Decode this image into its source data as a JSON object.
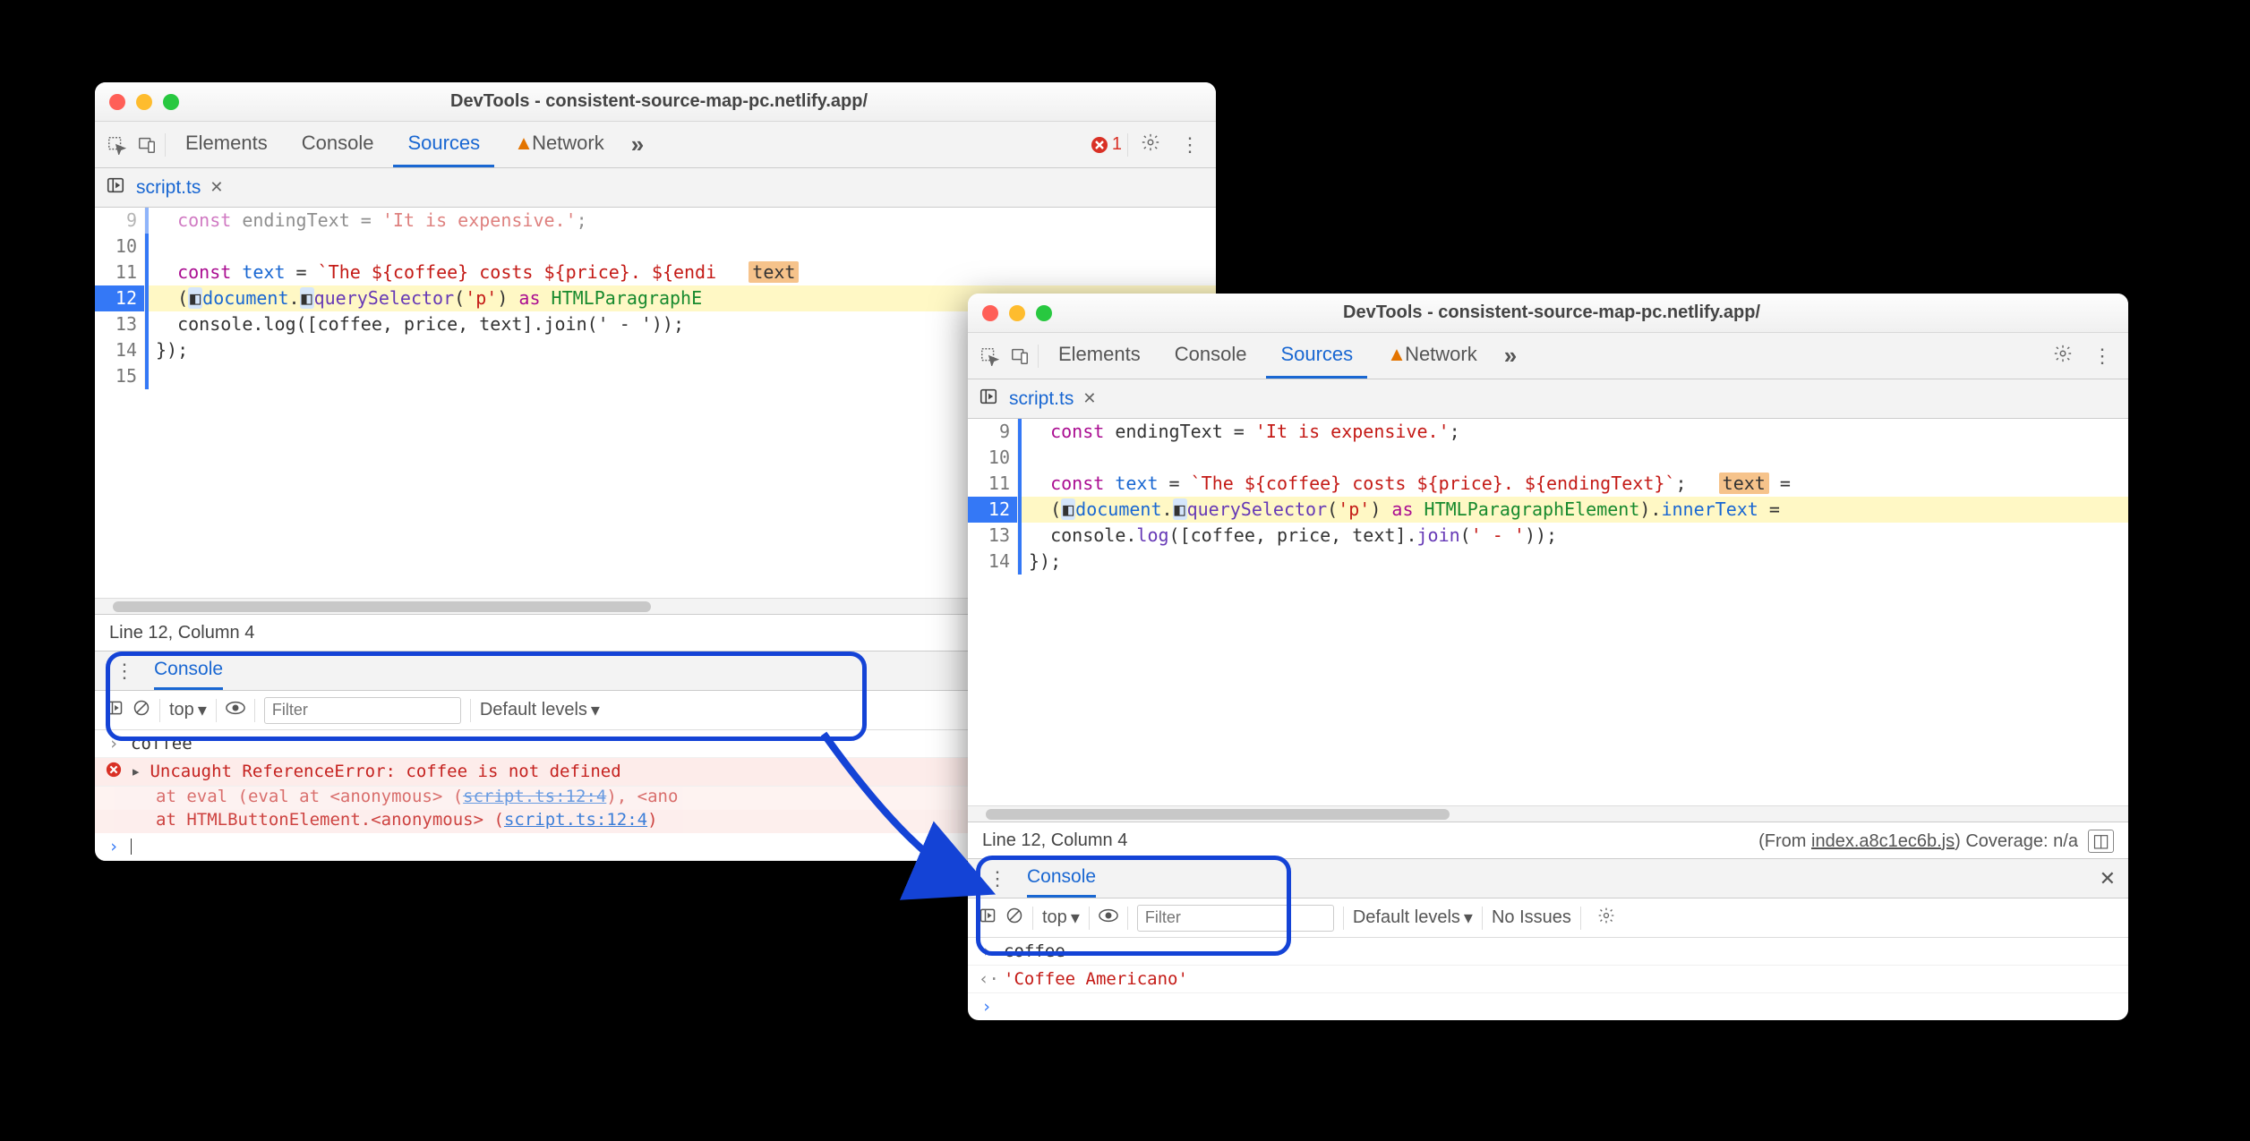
{
  "window1": {
    "title": "DevTools - consistent-source-map-pc.netlify.app/",
    "tabs": {
      "elements": "Elements",
      "console": "Console",
      "sources": "Sources",
      "network": "Network"
    },
    "error_count": "1",
    "file": "script.ts",
    "lines": {
      "l9_no": "9",
      "l9": "  const endingText = 'It is expensive.';",
      "l10_no": "10",
      "l10": "",
      "l11_no": "11",
      "l11_a": "  const ",
      "l11_b": "text",
      "l11_c": " = ",
      "l11_d": "`The ${coffee} costs ${price}. ${endi",
      "l11_tok": "text",
      "l12_no": "12",
      "l12_a": "  (",
      "l12_b": "document",
      "l12_c": ".",
      "l12_d": "querySelector",
      "l12_e": "(",
      "l12_f": "'p'",
      "l12_g": ") ",
      "l12_h": "as",
      "l12_i": " ",
      "l12_j": "HTMLParagraphE",
      "l13_no": "13",
      "l13": "  console.log([coffee, price, text].join(' - '));",
      "l14_no": "14",
      "l14": "});",
      "l15_no": "15",
      "l15": ""
    },
    "status_line": "Line 12, Column 4",
    "status_from": "(From ",
    "status_link": "index.a8c1ec6b.js",
    "status_close": ")",
    "drawer_tab": "Console",
    "toolbar": {
      "context": "top",
      "filter_ph": "Filter",
      "levels": "Default levels"
    },
    "console": {
      "input": "coffee",
      "err": "Uncaught ReferenceError: coffee is not defined",
      "trace1a": "    at eval (eval at <anonymous> (",
      "trace1b": "script.ts:12:4",
      "trace1c": "), <ano",
      "trace2a": "    at HTMLButtonElement.<anonymous> (",
      "trace2b": "script.ts:12:4",
      "trace2c": ")"
    }
  },
  "window2": {
    "title": "DevTools - consistent-source-map-pc.netlify.app/",
    "tabs": {
      "elements": "Elements",
      "console": "Console",
      "sources": "Sources",
      "network": "Network"
    },
    "file": "script.ts",
    "lines": {
      "l9_no": "9",
      "l9_a": "  const ",
      "l9_b": "endingText",
      "l9_c": " = ",
      "l9_d": "'It is expensive.'",
      "l9_e": ";",
      "l10_no": "10",
      "l10": "",
      "l11_no": "11",
      "l11_a": "  const ",
      "l11_b": "text",
      "l11_c": " = ",
      "l11_d": "`The ${coffee} costs ${price}. ${endingText}`",
      "l11_e": ";",
      "l11_tok": "text",
      "l11_eq": " =",
      "l12_no": "12",
      "l12_a": "  (",
      "l12_b": "document",
      "l12_c": ".",
      "l12_d": "querySelector",
      "l12_e": "(",
      "l12_f": "'p'",
      "l12_g": ") ",
      "l12_h": "as",
      "l12_i": " ",
      "l12_j": "HTMLParagraphElement",
      "l12_k": ").",
      "l12_l": "innerText",
      "l12_m": " =",
      "l13_no": "13",
      "l13_a": "  console.",
      "l13_b": "log",
      "l13_c": "([coffee, price, text].",
      "l13_d": "join",
      "l13_e": "(",
      "l13_f": "' - '",
      "l13_g": "));",
      "l14_no": "14",
      "l14": "});"
    },
    "status_line": "Line 12, Column 4",
    "status_from": "(From ",
    "status_link": "index.a8c1ec6b.js",
    "status_cov": ") Coverage: n/a",
    "drawer_tab": "Console",
    "toolbar": {
      "context": "top",
      "filter_ph": "Filter",
      "levels": "Default levels",
      "issues": "No Issues"
    },
    "console": {
      "input": "coffee",
      "output": "'Coffee Americano'"
    }
  }
}
